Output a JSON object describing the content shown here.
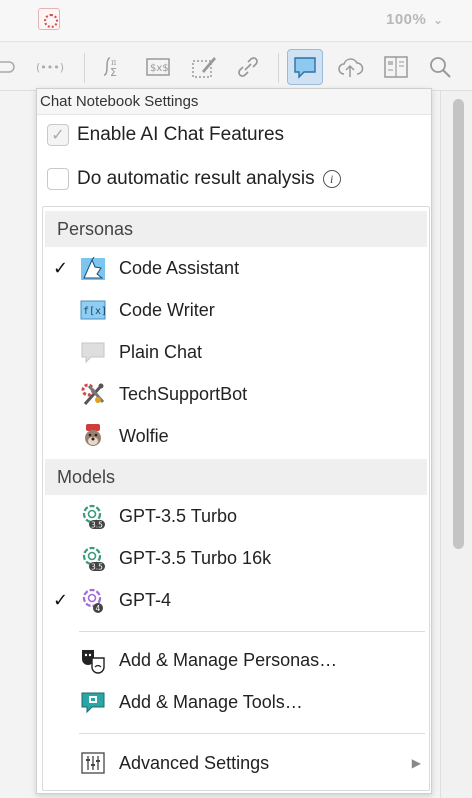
{
  "topbar": {
    "zoom_label": "100%"
  },
  "toolbar": {
    "buttons": [
      "formula-icon",
      "code-icon",
      "template-icon",
      "link-icon",
      "chat-icon",
      "cloud-upload-icon",
      "notebook-icon",
      "search-icon"
    ]
  },
  "menu": {
    "title": "Chat Notebook Settings",
    "enable_ai": {
      "label": "Enable AI Chat Features",
      "checked": true
    },
    "auto_analysis": {
      "label": "Do automatic result analysis",
      "checked": false
    },
    "personas_header": "Personas",
    "personas": [
      {
        "label": "Code Assistant",
        "selected": true,
        "icon": "code-assistant-icon"
      },
      {
        "label": "Code Writer",
        "selected": false,
        "icon": "code-writer-icon"
      },
      {
        "label": "Plain Chat",
        "selected": false,
        "icon": "plain-chat-icon"
      },
      {
        "label": "TechSupportBot",
        "selected": false,
        "icon": "tech-support-icon"
      },
      {
        "label": "Wolfie",
        "selected": false,
        "icon": "wolfie-icon"
      }
    ],
    "models_header": "Models",
    "models": [
      {
        "label": "GPT-3.5 Turbo",
        "selected": false,
        "badge": "3.5"
      },
      {
        "label": "GPT-3.5 Turbo 16k",
        "selected": false,
        "badge": "3.5"
      },
      {
        "label": "GPT-4",
        "selected": true,
        "badge": "4"
      }
    ],
    "manage_personas": "Add & Manage Personas…",
    "manage_tools": "Add & Manage Tools…",
    "advanced": "Advanced Settings",
    "check_mark": "✓",
    "info_glyph": "i",
    "submenu_arrow": "▶"
  },
  "colors": {
    "accent": "#cfe2f3",
    "gpt35": "#3a9a7a",
    "gpt4": "#a46bd6"
  }
}
